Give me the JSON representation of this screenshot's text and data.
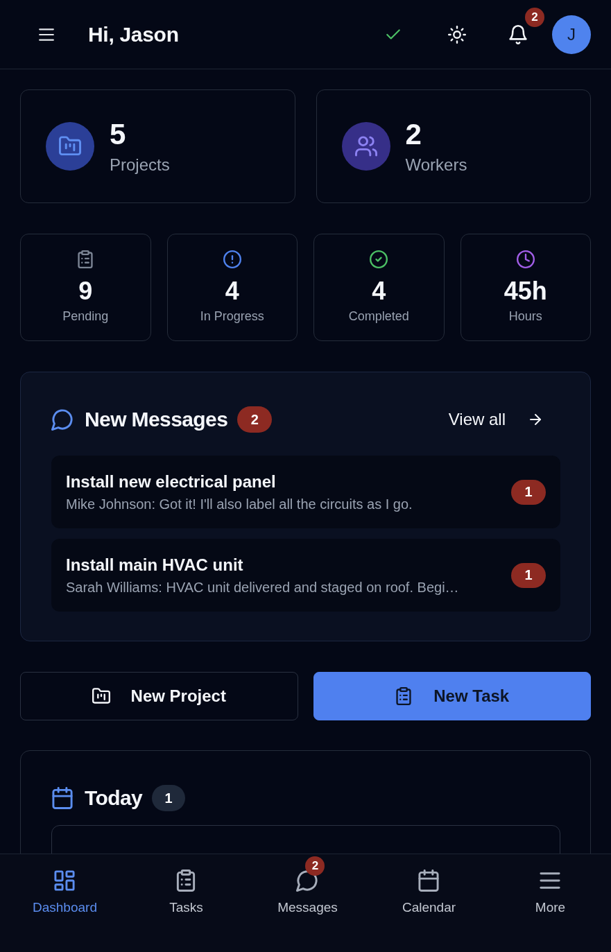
{
  "header": {
    "title": "Hi, Jason",
    "notifications": "2",
    "avatar": "J"
  },
  "summary": [
    {
      "kind": "projects",
      "value": "5",
      "label": "Projects"
    },
    {
      "kind": "workers",
      "value": "2",
      "label": "Workers"
    }
  ],
  "stats": [
    {
      "kind": "pending",
      "value": "9",
      "label": "Pending",
      "color": "#7c8595"
    },
    {
      "kind": "in_progress",
      "value": "4",
      "label": "In Progress",
      "color": "#4f82ee"
    },
    {
      "kind": "completed",
      "value": "4",
      "label": "Completed",
      "color": "#4cc065"
    },
    {
      "kind": "hours",
      "value": "45h",
      "label": "Hours",
      "color": "#a25ee8"
    }
  ],
  "messages": {
    "title": "New Messages",
    "count": "2",
    "view_all": "View all",
    "items": [
      {
        "title": "Install new electrical panel",
        "preview": "Mike Johnson: Got it! I'll also label all the circuits as I go.",
        "unread": "1"
      },
      {
        "title": "Install main HVAC unit",
        "preview": "Sarah Williams: HVAC unit delivered and staged on roof. Begi…",
        "unread": "1"
      }
    ]
  },
  "actions": [
    {
      "kind": "outline",
      "label": "New Project"
    },
    {
      "kind": "primary",
      "label": "New Task"
    }
  ],
  "today": {
    "title": "Today",
    "count": "1"
  },
  "nav": [
    {
      "kind": "dashboard",
      "label": "Dashboard",
      "selected": true
    },
    {
      "kind": "tasks",
      "label": "Tasks",
      "selected": false
    },
    {
      "kind": "messages",
      "label": "Messages",
      "selected": false,
      "badge": "2"
    },
    {
      "kind": "calendar",
      "label": "Calendar",
      "selected": false
    },
    {
      "kind": "more",
      "label": "More",
      "selected": false
    }
  ]
}
